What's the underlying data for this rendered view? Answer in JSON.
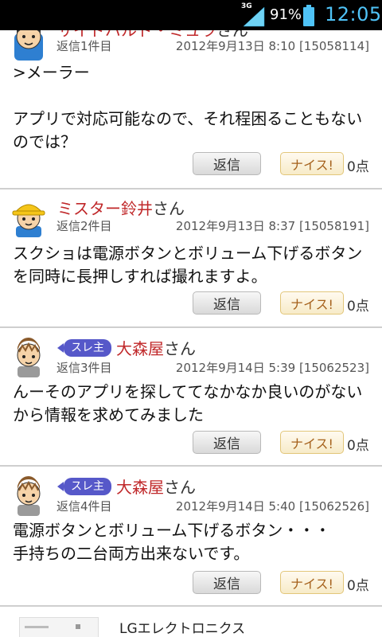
{
  "status_bar": {
    "network": "3G",
    "battery_percent": "91%",
    "time": "12:05"
  },
  "posts": [
    {
      "name": "サイドバルド・ミュラ",
      "honorific": "さん",
      "reply_index": "返信1件目",
      "date": "2012年9月13日 8:10 [15058114]",
      "body": ">メーラー\n\nアプリで対応可能なので、それ程困ることもないのでは？",
      "reply_label": "返信",
      "nice_label": "ナイス!",
      "nice_count": "0点"
    },
    {
      "name": "ミスター鈴井",
      "honorific": "さん",
      "reply_index": "返信2件目",
      "date": "2012年9月13日 8:37 [15058191]",
      "body": "スクショは電源ボタンとボリューム下げるボタンを同時に長押しすれば撮れますよ。",
      "reply_label": "返信",
      "nice_label": "ナイス!",
      "nice_count": "0点"
    },
    {
      "owner_tag": "スレ主",
      "name": "大森屋",
      "honorific": "さん",
      "reply_index": "返信3件目",
      "date": "2012年9月14日 5:39 [15062523]",
      "body": "んーそのアプリを探しててなかなか良いのがないから情報を求めてみました",
      "reply_label": "返信",
      "nice_label": "ナイス!",
      "nice_count": "0点"
    },
    {
      "owner_tag": "スレ主",
      "name": "大森屋",
      "honorific": "さん",
      "reply_index": "返信4件目",
      "date": "2012年9月14日 5:40 [15062526]",
      "body": "電源ボタンとボリューム下げるボタン・・・\n手持ちの二台両方出来ないです。",
      "reply_label": "返信",
      "nice_label": "ナイス!",
      "nice_count": "0点"
    }
  ],
  "product": {
    "maker": "LGエレクトロニクス"
  },
  "colors": {
    "name": "#c0282a",
    "owner_tag": "#5658c9",
    "clock": "#4fc3f7"
  }
}
